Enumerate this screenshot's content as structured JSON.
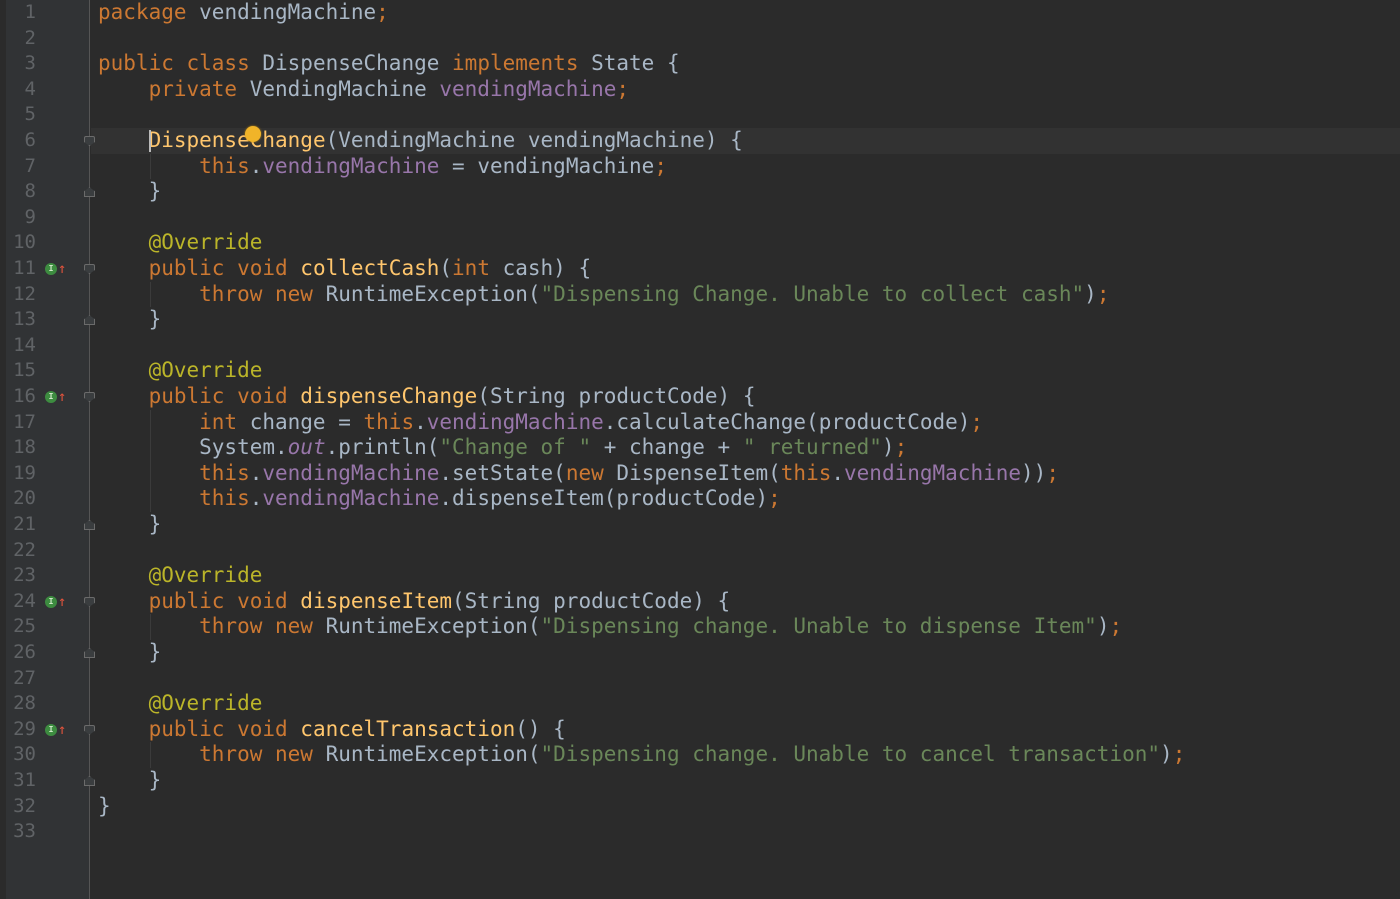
{
  "editor": {
    "file_package": "vendingMachine",
    "line_numbers": [
      "1",
      "2",
      "3",
      "4",
      "5",
      "6",
      "7",
      "8",
      "9",
      "10",
      "11",
      "12",
      "13",
      "14",
      "15",
      "16",
      "17",
      "18",
      "19",
      "20",
      "21",
      "22",
      "23",
      "24",
      "25",
      "26",
      "27",
      "28",
      "29",
      "30",
      "31",
      "32",
      "33"
    ],
    "implements_marker_lines": [
      "11",
      "16",
      "24",
      "29"
    ],
    "lines": [
      [
        {
          "t": "package ",
          "c": "kw"
        },
        {
          "t": "vendingMachine",
          "c": "pl"
        },
        {
          "t": ";",
          "c": "kw"
        }
      ],
      [],
      [
        {
          "t": "public class ",
          "c": "kw"
        },
        {
          "t": "DispenseChange ",
          "c": "pl"
        },
        {
          "t": "implements ",
          "c": "kw"
        },
        {
          "t": "State {",
          "c": "pl"
        }
      ],
      [
        {
          "t": "    private ",
          "c": "kw"
        },
        {
          "t": "VendingMachine ",
          "c": "pl"
        },
        {
          "t": "vendingMachine",
          "c": "fld"
        },
        {
          "t": ";",
          "c": "kw"
        }
      ],
      [],
      [
        {
          "t": "    ",
          "c": "pl"
        },
        {
          "t": "DispenseChange",
          "c": "fn"
        },
        {
          "t": "(VendingMachine vendingMachine) {",
          "c": "pl"
        }
      ],
      [
        {
          "t": "        this",
          "c": "kw"
        },
        {
          "t": ".",
          "c": "pl"
        },
        {
          "t": "vendingMachine",
          "c": "fld"
        },
        {
          "t": " = vendingMachine",
          "c": "pl"
        },
        {
          "t": ";",
          "c": "kw"
        }
      ],
      [
        {
          "t": "    }",
          "c": "pl"
        }
      ],
      [],
      [
        {
          "t": "    @Override",
          "c": "ann"
        }
      ],
      [
        {
          "t": "    public void ",
          "c": "kw"
        },
        {
          "t": "collectCash",
          "c": "fn"
        },
        {
          "t": "(",
          "c": "pl"
        },
        {
          "t": "int ",
          "c": "kw"
        },
        {
          "t": "cash) {",
          "c": "pl"
        }
      ],
      [
        {
          "t": "        throw new ",
          "c": "kw"
        },
        {
          "t": "RuntimeException(",
          "c": "pl"
        },
        {
          "t": "\"Dispensing Change. Unable to collect cash\"",
          "c": "str"
        },
        {
          "t": ")",
          "c": "pl"
        },
        {
          "t": ";",
          "c": "kw"
        }
      ],
      [
        {
          "t": "    }",
          "c": "pl"
        }
      ],
      [],
      [
        {
          "t": "    @Override",
          "c": "ann"
        }
      ],
      [
        {
          "t": "    public void ",
          "c": "kw"
        },
        {
          "t": "dispenseChange",
          "c": "fn"
        },
        {
          "t": "(String productCode) {",
          "c": "pl"
        }
      ],
      [
        {
          "t": "        int ",
          "c": "kw"
        },
        {
          "t": "change = ",
          "c": "pl"
        },
        {
          "t": "this",
          "c": "kw"
        },
        {
          "t": ".",
          "c": "pl"
        },
        {
          "t": "vendingMachine",
          "c": "fld"
        },
        {
          "t": ".calculateChange(productCode)",
          "c": "pl"
        },
        {
          "t": ";",
          "c": "kw"
        }
      ],
      [
        {
          "t": "        System.",
          "c": "pl"
        },
        {
          "t": "out",
          "c": "ital"
        },
        {
          "t": ".println(",
          "c": "pl"
        },
        {
          "t": "\"Change of \"",
          "c": "str"
        },
        {
          "t": " + change + ",
          "c": "pl"
        },
        {
          "t": "\" returned\"",
          "c": "str"
        },
        {
          "t": ")",
          "c": "pl"
        },
        {
          "t": ";",
          "c": "kw"
        }
      ],
      [
        {
          "t": "        this",
          "c": "kw"
        },
        {
          "t": ".",
          "c": "pl"
        },
        {
          "t": "vendingMachine",
          "c": "fld"
        },
        {
          "t": ".setState(",
          "c": "pl"
        },
        {
          "t": "new ",
          "c": "kw"
        },
        {
          "t": "DispenseItem(",
          "c": "pl"
        },
        {
          "t": "this",
          "c": "kw"
        },
        {
          "t": ".",
          "c": "pl"
        },
        {
          "t": "vendingMachine",
          "c": "fld"
        },
        {
          "t": "))",
          "c": "pl"
        },
        {
          "t": ";",
          "c": "kw"
        }
      ],
      [
        {
          "t": "        this",
          "c": "kw"
        },
        {
          "t": ".",
          "c": "pl"
        },
        {
          "t": "vendingMachine",
          "c": "fld"
        },
        {
          "t": ".dispenseItem(productCode)",
          "c": "pl"
        },
        {
          "t": ";",
          "c": "kw"
        }
      ],
      [
        {
          "t": "    }",
          "c": "pl"
        }
      ],
      [],
      [
        {
          "t": "    @Override",
          "c": "ann"
        }
      ],
      [
        {
          "t": "    public void ",
          "c": "kw"
        },
        {
          "t": "dispenseItem",
          "c": "fn"
        },
        {
          "t": "(String productCode) {",
          "c": "pl"
        }
      ],
      [
        {
          "t": "        throw new ",
          "c": "kw"
        },
        {
          "t": "RuntimeException(",
          "c": "pl"
        },
        {
          "t": "\"Dispensing change. Unable to dispense Item\"",
          "c": "str"
        },
        {
          "t": ")",
          "c": "pl"
        },
        {
          "t": ";",
          "c": "kw"
        }
      ],
      [
        {
          "t": "    }",
          "c": "pl"
        }
      ],
      [],
      [
        {
          "t": "    @Override",
          "c": "ann"
        }
      ],
      [
        {
          "t": "    public void ",
          "c": "kw"
        },
        {
          "t": "cancelTransaction",
          "c": "fn"
        },
        {
          "t": "() {",
          "c": "pl"
        }
      ],
      [
        {
          "t": "        throw new ",
          "c": "kw"
        },
        {
          "t": "RuntimeException(",
          "c": "pl"
        },
        {
          "t": "\"Dispensing change. Unable to cancel transaction\"",
          "c": "str"
        },
        {
          "t": ")",
          "c": "pl"
        },
        {
          "t": ";",
          "c": "kw"
        }
      ],
      [
        {
          "t": "    }",
          "c": "pl"
        }
      ],
      [
        {
          "t": "}",
          "c": "pl"
        }
      ],
      []
    ],
    "fold_open_lines": [
      "6",
      "11",
      "16",
      "24",
      "29"
    ],
    "fold_close_lines": [
      "8",
      "13",
      "21",
      "26",
      "31"
    ],
    "caret_line": "6",
    "colors": {
      "background": "#2b2b2b",
      "gutter": "#313335",
      "keyword": "#cc7832",
      "field": "#9876aa",
      "method": "#ffc66d",
      "string": "#6a8759",
      "annotation": "#bbb529",
      "plain": "#a9b7c6",
      "line_number": "#606366"
    }
  }
}
